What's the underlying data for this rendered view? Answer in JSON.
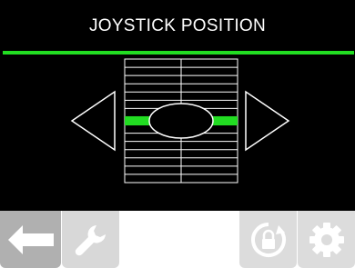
{
  "header": {
    "title": "JOYSTICK POSITION"
  },
  "colors": {
    "accent": "#22dd22",
    "background": "#000000",
    "grid": "#ffffff",
    "toolbar_active": "#b0b0b0",
    "toolbar_inactive": "#d8d8d8"
  },
  "joystick": {
    "rows": 15,
    "indicator_row": 7,
    "indicator_position": 0.5
  },
  "navigation": {
    "left_arrow_icon": "triangle-left-icon",
    "right_arrow_icon": "triangle-right-icon"
  },
  "toolbar": {
    "items": [
      {
        "name": "back",
        "icon": "arrow-left-icon",
        "state": "active"
      },
      {
        "name": "settings-wrench",
        "icon": "wrench-icon",
        "state": "disabled"
      },
      {
        "name": "lock",
        "icon": "lock-rotate-icon",
        "state": "disabled"
      },
      {
        "name": "settings-gear",
        "icon": "gear-icon",
        "state": "disabled"
      }
    ]
  }
}
